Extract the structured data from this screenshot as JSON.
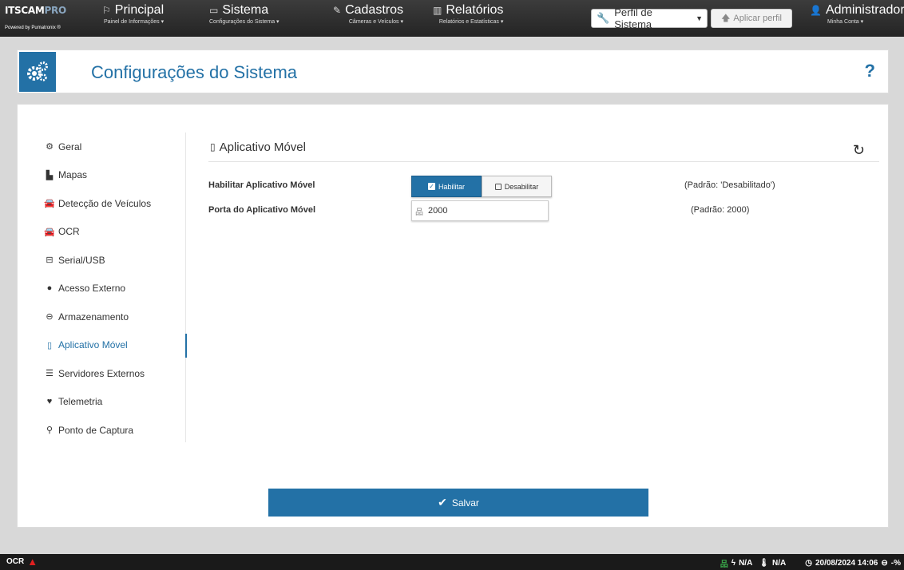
{
  "brand": {
    "logo_main": "ITSCAM",
    "logo_accent": "PRO",
    "logo_powered": "Powered by Pumatronix ®"
  },
  "nav": {
    "principal": {
      "icon": "flag-icon",
      "title": "Principal",
      "subtitle": "Painel de Informações ▾"
    },
    "sistema": {
      "icon": "monitor-icon",
      "title": "Sistema",
      "subtitle": "Configurações do Sistema ▾"
    },
    "cadastros": {
      "icon": "edit-icon",
      "title": "Cadastros",
      "subtitle": "Câmeras e Veículos ▾"
    },
    "relatorios": {
      "icon": "bar-chart-icon",
      "title": "Relatórios",
      "subtitle": "Relatórios e Estatísticas ▾"
    }
  },
  "profile": {
    "selected": "Perfil de Sistema",
    "apply_label": "Aplicar perfil"
  },
  "user": {
    "name": "Administrador",
    "subtitle": "Minha Conta ▾"
  },
  "page": {
    "title": "Configurações do Sistema",
    "help": "?"
  },
  "sidebar": {
    "items": [
      {
        "label": "Geral",
        "icon": "gears-icon"
      },
      {
        "label": "Mapas",
        "icon": "map-icon"
      },
      {
        "label": "Detecção de Veículos",
        "icon": "car-icon"
      },
      {
        "label": "OCR",
        "icon": "car-icon"
      },
      {
        "label": "Serial/USB",
        "icon": "serial-icon"
      },
      {
        "label": "Acesso Externo",
        "icon": "globe-icon"
      },
      {
        "label": "Armazenamento",
        "icon": "hdd-icon"
      },
      {
        "label": "Aplicativo Móvel",
        "icon": "mobile-icon",
        "active": true
      },
      {
        "label": "Servidores Externos",
        "icon": "server-icon"
      },
      {
        "label": "Telemetria",
        "icon": "heartbeat-icon"
      },
      {
        "label": "Ponto de Captura",
        "icon": "pin-icon"
      }
    ]
  },
  "section": {
    "title": "Aplicativo Móvel",
    "rows": {
      "enable": {
        "label": "Habilitar Aplicativo Móvel",
        "on_label": "Habilitar",
        "off_label": "Desabilitar",
        "default": "(Padrão: 'Desabilitado')"
      },
      "port": {
        "label": "Porta do Aplicativo Móvel",
        "value": "2000",
        "default": "(Padrão: 2000)"
      }
    }
  },
  "save_label": "Salvar",
  "status": {
    "left_label": "OCR",
    "na1": "N/A",
    "na2": "N/A",
    "datetime": "20/08/2024 14:06",
    "disk": "-%"
  },
  "colors": {
    "accent": "#2371a6",
    "warning": "#e02020",
    "ok": "#3aa84a"
  }
}
